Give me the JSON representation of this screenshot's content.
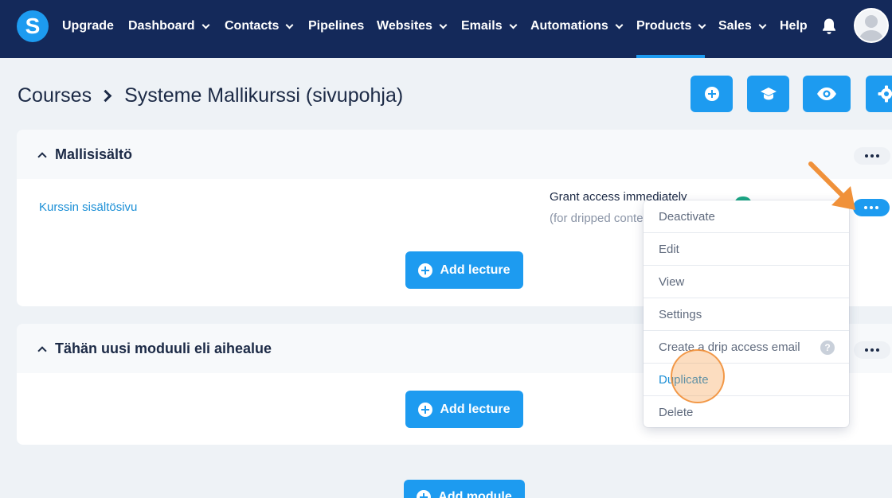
{
  "nav": {
    "logo_letter": "S",
    "items": [
      {
        "label": "Upgrade",
        "has_dropdown": false
      },
      {
        "label": "Dashboard",
        "has_dropdown": true
      },
      {
        "label": "Contacts",
        "has_dropdown": true
      },
      {
        "label": "Pipelines",
        "has_dropdown": false
      },
      {
        "label": "Websites",
        "has_dropdown": true
      },
      {
        "label": "Emails",
        "has_dropdown": true
      },
      {
        "label": "Automations",
        "has_dropdown": true
      },
      {
        "label": "Products",
        "has_dropdown": true,
        "active": true
      },
      {
        "label": "Sales",
        "has_dropdown": true
      },
      {
        "label": "Help",
        "has_dropdown": false
      }
    ],
    "icons": [
      "bell-icon",
      "avatar"
    ]
  },
  "header": {
    "breadcrumb_root": "Courses",
    "breadcrumb_current": "Systeme Mallikurssi (sivupohja)",
    "action_icons": [
      "add-icon",
      "graduation-cap-icon",
      "eye-icon",
      "gear-icon"
    ]
  },
  "modules": [
    {
      "title": "Mallisisältö",
      "lectures": [
        {
          "title": "Kurssin sisältösivu",
          "access": "Grant access immediately",
          "access_note": "(for dripped content)"
        }
      ],
      "add_lecture_label": "Add lecture"
    },
    {
      "title": "Tähän uusi moduuli eli aihealue",
      "lectures": [],
      "add_lecture_label": "Add lecture"
    }
  ],
  "add_module_label": "Add module",
  "lecture_menu": {
    "items": [
      {
        "label": "Deactivate"
      },
      {
        "label": "Edit"
      },
      {
        "label": "View"
      },
      {
        "label": "Settings"
      },
      {
        "label": "Create a drip access email",
        "help": "?"
      },
      {
        "label": "Duplicate",
        "highlighted": true
      },
      {
        "label": "Delete"
      }
    ]
  },
  "colors": {
    "nav_bg": "#14295a",
    "accent": "#1d9bf0",
    "page_bg": "#eef2f6",
    "toggle_on": "#1ba784",
    "annotation": "#f0913a"
  }
}
